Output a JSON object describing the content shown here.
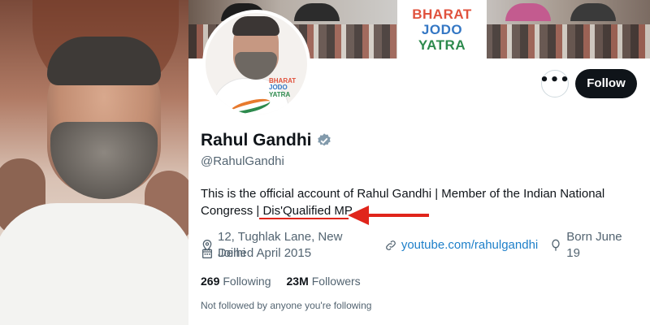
{
  "banner": {
    "sign_line1": "BHARAT",
    "sign_line2": "JODO",
    "sign_line3": "YATRA"
  },
  "avatar": {
    "logo_line1": "BHARAT",
    "logo_line2": "JODO",
    "logo_line3": "YATRA"
  },
  "actions": {
    "more_label": "•••",
    "follow_label": "Follow"
  },
  "profile": {
    "name": "Rahul Gandhi",
    "handle": "@RahulGandhi",
    "bio_main": "This is the official account of Rahul Gandhi | Member of the Indian National Congress | ",
    "bio_highlight": "Dis'Qualified MP",
    "location": "12, Tughlak Lane, New Delhi",
    "website": "youtube.com/rahulgandhi",
    "birthday": "Born June 19",
    "joined": "Joined April 2015"
  },
  "stats": {
    "following_count": "269",
    "following_label": "Following",
    "followers_count": "23M",
    "followers_label": "Followers"
  },
  "footer": {
    "not_followed": "Not followed by anyone you're following"
  },
  "colors": {
    "verified": "#829aab",
    "annotation_red": "#e0251b",
    "link": "#1d7fc9"
  }
}
